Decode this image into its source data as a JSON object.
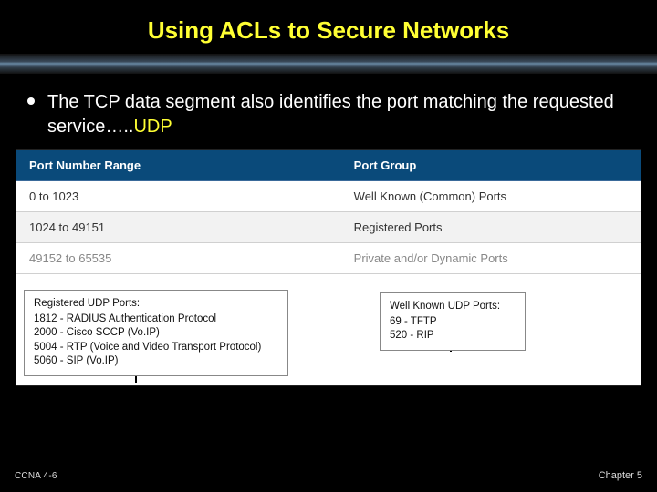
{
  "title": "Using ACLs to Secure Networks",
  "bullet": {
    "text_main": "The TCP data segment also identifies the port matching the requested service…..",
    "text_udp": "UDP"
  },
  "table": {
    "headers": {
      "col1": "Port Number Range",
      "col2": "Port Group"
    },
    "rows": [
      {
        "range": "0 to 1023",
        "group": "Well Known (Common) Ports"
      },
      {
        "range": "1024 to 49151",
        "group": "Registered Ports"
      },
      {
        "range": "49152 to 65535",
        "group": "Private and/or Dynamic Ports"
      }
    ]
  },
  "callout_left": {
    "heading": "Registered UDP Ports:",
    "lines": [
      "1812 - RADIUS Authentication Protocol",
      "2000 - Cisco SCCP (Vo.IP)",
      "5004 - RTP (Voice and Video Transport Protocol)",
      "5060 - SIP (Vo.IP)"
    ]
  },
  "callout_right": {
    "heading": "Well Known UDP Ports:",
    "lines": [
      "69 - TFTP",
      "520 - RIP"
    ]
  },
  "footer": {
    "left": "CCNA 4-6",
    "right": "Chapter 5"
  }
}
